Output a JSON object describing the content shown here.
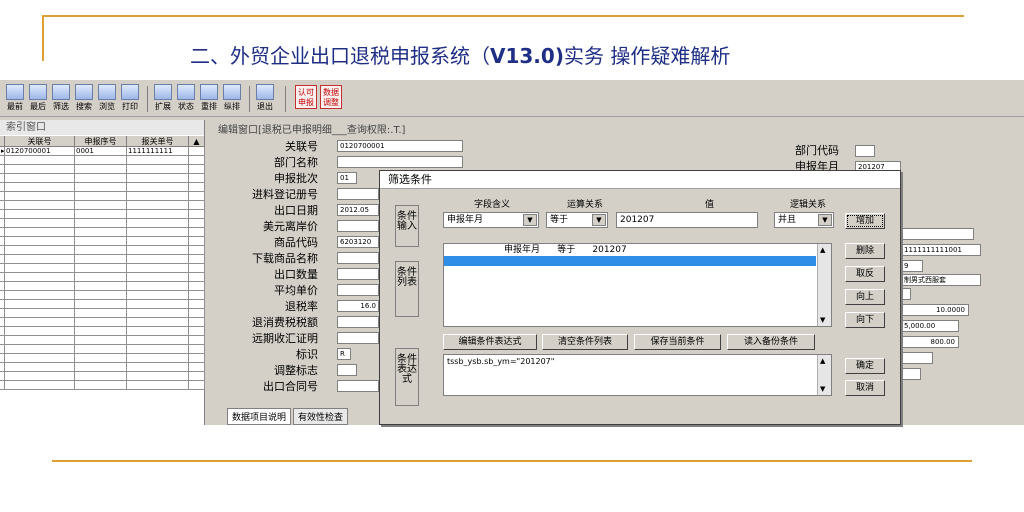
{
  "slide": {
    "title_prefix": "二、外贸企业出口退税申报系统（",
    "title_version": "V13.0)",
    "title_suffix": "实务 操作疑难解析"
  },
  "toolbar": {
    "buttons": [
      "最前",
      "最后",
      "筛选",
      "搜索",
      "浏览",
      "打印",
      "扩展",
      "状态",
      "重排",
      "纵排",
      "退出"
    ],
    "red_buttons": [
      "认可申报",
      "数据调整"
    ]
  },
  "index_window": {
    "title": "索引窗口",
    "columns": [
      "关联号",
      "申报序号",
      "报关单号"
    ],
    "rows": [
      [
        "0120700001",
        "0001",
        "1111111111"
      ]
    ]
  },
  "edit_window": {
    "title": "编辑窗口[退税已申报明细___查询权限:.T.]",
    "fields": [
      {
        "label": "关联号",
        "value": "0120700001"
      },
      {
        "label": "部门名称",
        "value": ""
      },
      {
        "label": "申报批次",
        "value": "01"
      },
      {
        "label": "进料登记册号",
        "value": ""
      },
      {
        "label": "出口日期",
        "value": "2012.05"
      },
      {
        "label": "美元离岸价",
        "value": ""
      },
      {
        "label": "商品代码",
        "value": "6203120"
      },
      {
        "label": "下载商品名称",
        "value": ""
      },
      {
        "label": "出口数量",
        "value": ""
      },
      {
        "label": "平均单价",
        "value": ""
      },
      {
        "label": "退税率",
        "value": "16.0"
      },
      {
        "label": "退消费税税额",
        "value": ""
      },
      {
        "label": "远期收汇证明",
        "value": ""
      },
      {
        "label": "标识",
        "value": "R"
      },
      {
        "label": "调整标志",
        "value": ""
      },
      {
        "label": "出口合同号",
        "value": ""
      }
    ],
    "right_fields": [
      {
        "label": "部门代码",
        "value": ""
      },
      {
        "label": "申报年月",
        "value": "201207"
      }
    ],
    "right_values": [
      "1111111111001",
      "9",
      "制男式西服套",
      "10.0000",
      "5,000.00",
      "800.00"
    ],
    "tabs": [
      "数据项目说明",
      "有效性检查"
    ]
  },
  "dialog": {
    "title": "筛选条件",
    "side_labels": [
      "条件输入",
      "条件列表",
      "条件表达式"
    ],
    "headers": {
      "field": "字段含义",
      "op": "运算关系",
      "value": "值",
      "logic": "逻辑关系"
    },
    "field_select": "申报年月",
    "op_select": "等于",
    "value_input": "201207",
    "logic_select": "并且",
    "add_button": "增加",
    "delete_button": "删除",
    "invert_button": "取反",
    "up_button": "向上",
    "down_button": "向下",
    "list_items": [
      {
        "field": "申报年月",
        "op": "等于",
        "value": "201207"
      }
    ],
    "action_buttons": [
      "编辑条件表达式",
      "清空条件列表",
      "保存当前条件",
      "读入备份条件"
    ],
    "expression": "tssb_ysb.sb_ym=\"201207\"",
    "ok_button": "确定",
    "cancel_button": "取消"
  }
}
